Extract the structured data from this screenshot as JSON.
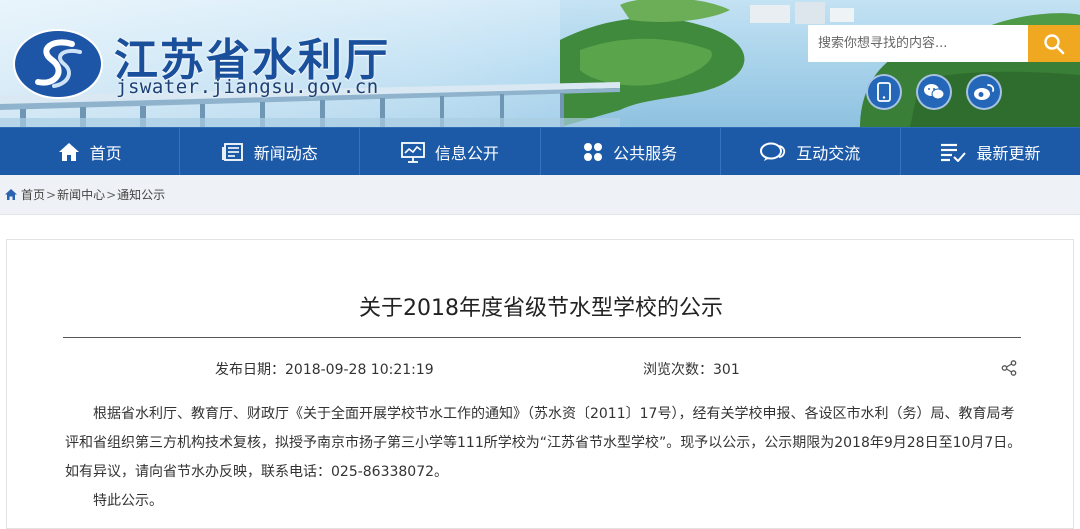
{
  "site": {
    "name": "江苏省水利厅",
    "domain": "jswater.jiangsu.gov.cn"
  },
  "search": {
    "placeholder": "搜索你想寻找的内容..."
  },
  "nav": {
    "items": [
      {
        "label": "首页",
        "icon": "home-icon"
      },
      {
        "label": "新闻动态",
        "icon": "newspaper-icon"
      },
      {
        "label": "信息公开",
        "icon": "presentation-icon"
      },
      {
        "label": "公共服务",
        "icon": "grid-icon"
      },
      {
        "label": "互动交流",
        "icon": "chat-icon"
      },
      {
        "label": "最新更新",
        "icon": "list-check-icon"
      }
    ]
  },
  "breadcrumb": {
    "items": [
      "首页",
      "新闻中心",
      "通知公示"
    ],
    "separator": ">"
  },
  "article": {
    "title": "关于2018年度省级节水型学校的公示",
    "publish_date": "发布日期：2018-09-28 10:21:19",
    "views": "浏览次数：301",
    "paragraphs": [
      "根据省水利厅、教育厅、财政厅《关于全面开展学校节水工作的通知》（苏水资〔2011〕17号），经有关学校申报、各设区市水利（务）局、教育局考评和省组织第三方机构技术复核，拟授予南京市扬子第三小学等111所学校为“江苏省节水型学校”。现予以公示，公示期限为2018年9月28日至10月7日。如有异议，请向省节水办反映，联系电话：025-86338072。",
      "特此公示。"
    ]
  },
  "colors": {
    "nav_bg": "#1c5aa8",
    "brand_blue": "#1a4f9c",
    "search_button": "#f0a820"
  }
}
